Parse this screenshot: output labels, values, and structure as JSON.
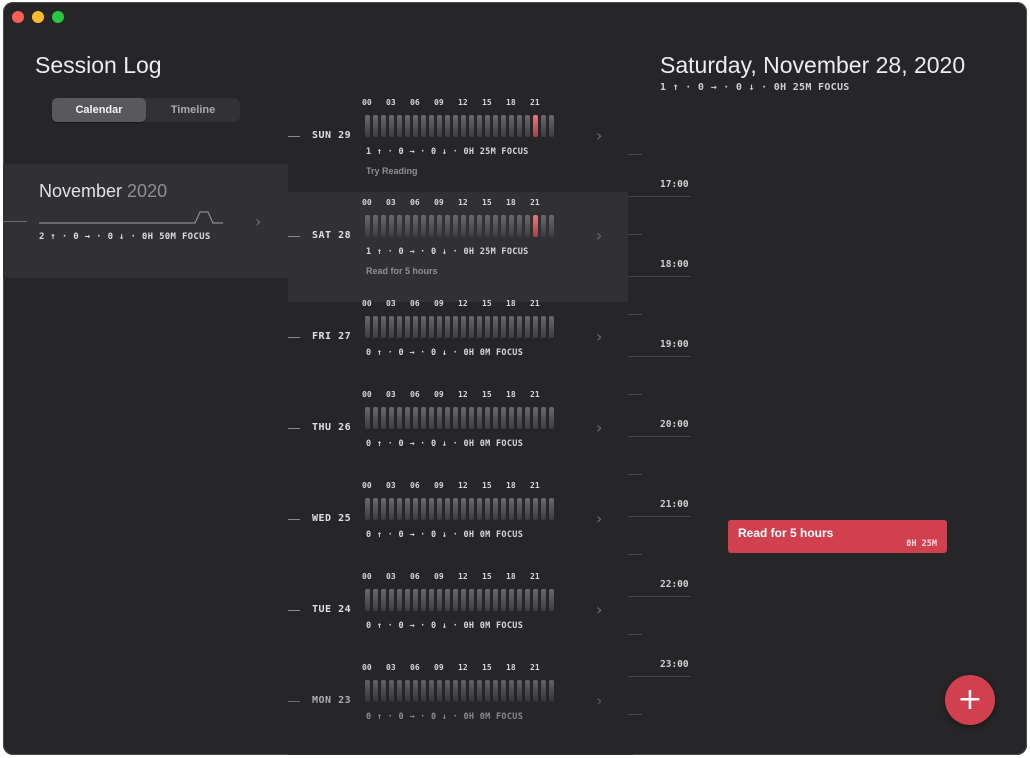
{
  "app": {
    "title": "Session Log"
  },
  "view_toggle": {
    "options": [
      "Calendar",
      "Timeline"
    ],
    "selected": "Calendar"
  },
  "month": {
    "name": "November",
    "year": "2020",
    "stats": "2 ↑ · 0 → · 0 ↓ · 0H 50M FOCUS"
  },
  "hour_marks": [
    "00",
    "03",
    "06",
    "09",
    "12",
    "15",
    "18",
    "21"
  ],
  "days": [
    {
      "label": "SUN 29",
      "stats": "1 ↑ · 0 → · 0 ↓ · 0H 25M FOCUS",
      "note": "Try Reading",
      "active_hours": [
        21
      ],
      "selected": false
    },
    {
      "label": "SAT 28",
      "stats": "1 ↑ · 0 → · 0 ↓ · 0H 25M FOCUS",
      "note": "Read for 5 hours",
      "active_hours": [
        21
      ],
      "selected": true
    },
    {
      "label": "FRI 27",
      "stats": "0 ↑ · 0 → · 0 ↓ · 0H 0M FOCUS",
      "note": "",
      "active_hours": [],
      "selected": false
    },
    {
      "label": "THU 26",
      "stats": "0 ↑ · 0 → · 0 ↓ · 0H 0M FOCUS",
      "note": "",
      "active_hours": [],
      "selected": false
    },
    {
      "label": "WED 25",
      "stats": "0 ↑ · 0 → · 0 ↓ · 0H 0M FOCUS",
      "note": "",
      "active_hours": [],
      "selected": false
    },
    {
      "label": "TUE 24",
      "stats": "0 ↑ · 0 → · 0 ↓ · 0H 0M FOCUS",
      "note": "",
      "active_hours": [],
      "selected": false
    },
    {
      "label": "MON 23",
      "stats": "0 ↑ · 0 → · 0 ↓ · 0H 0M FOCUS",
      "note": "",
      "active_hours": [],
      "selected": false
    }
  ],
  "detail": {
    "date": "Saturday, November 28, 2020",
    "stats": "1 ↑ · 0 → · 0 ↓ · 0H 25M FOCUS",
    "times": [
      "17:00",
      "18:00",
      "19:00",
      "20:00",
      "21:00",
      "22:00",
      "23:00"
    ],
    "event": {
      "title": "Read for 5 hours",
      "duration": "0H 25M"
    }
  },
  "icons": {
    "chevron": "chevron-right-icon",
    "add": "plus-icon"
  },
  "colors": {
    "accent": "#d1404f",
    "background": "#262527",
    "panel": "#313032"
  }
}
